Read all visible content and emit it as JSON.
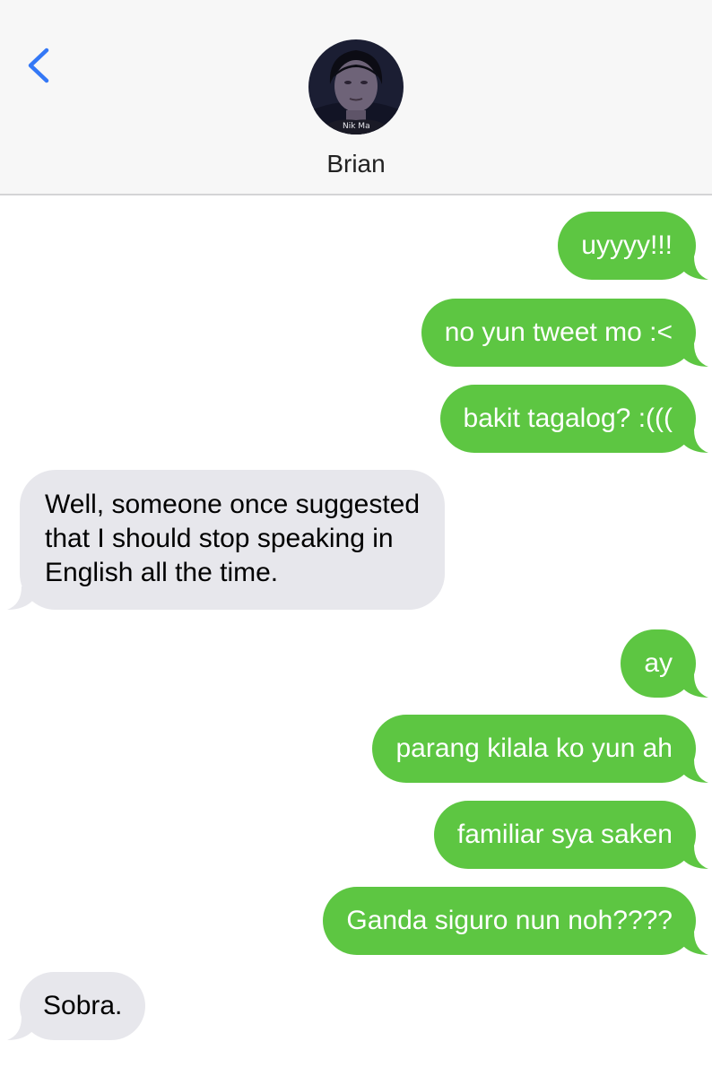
{
  "header": {
    "contact_name": "Brian",
    "avatar_caption": "Nik Ma"
  },
  "colors": {
    "sent_bubble": "#5dc642",
    "received_bubble": "#e7e7ec",
    "accent": "#3478f6"
  },
  "messages": [
    {
      "from": "me",
      "text": "uyyyy!!!"
    },
    {
      "from": "me",
      "text": "no yun tweet mo :<"
    },
    {
      "from": "me",
      "text": "bakit tagalog? :((("
    },
    {
      "from": "them",
      "lines": [
        "Well, someone once suggested",
        "that I should stop speaking in",
        "English all the time."
      ]
    },
    {
      "from": "me",
      "text": "ay"
    },
    {
      "from": "me",
      "text": "parang kilala ko yun ah"
    },
    {
      "from": "me",
      "text": "familiar sya saken"
    },
    {
      "from": "me",
      "text": "Ganda siguro nun noh????"
    },
    {
      "from": "them",
      "text": "Sobra."
    }
  ]
}
